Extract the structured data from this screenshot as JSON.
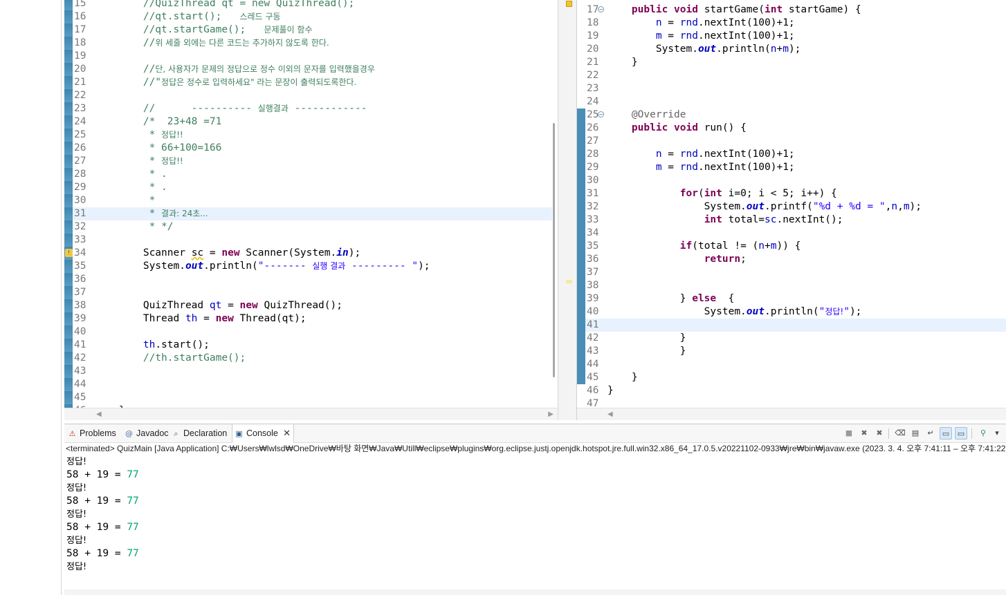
{
  "left_editor": {
    "lines": [
      {
        "n": "15",
        "segs": [
          [
            "cm",
            "        //QuizThread qt = new QuizThread();"
          ]
        ]
      },
      {
        "n": "16",
        "segs": [
          [
            "cm",
            "        //qt.start();   "
          ],
          [
            "cmk",
            "스레드 구동"
          ]
        ]
      },
      {
        "n": "17",
        "segs": [
          [
            "cm",
            "        //qt.startGame();   "
          ],
          [
            "cmk",
            "문제풀이 함수"
          ]
        ]
      },
      {
        "n": "18",
        "segs": [
          [
            "cm",
            "        //"
          ],
          [
            "cmk",
            "위 세줄 외에는 다른 코드는 추가하지 않도록 한다."
          ]
        ]
      },
      {
        "n": "19",
        "segs": []
      },
      {
        "n": "20",
        "segs": [
          [
            "cm",
            "        //"
          ],
          [
            "cmk",
            "단, 사용자가 문제의 정답으로 정수 이외의 문자를 입력했을경우"
          ]
        ]
      },
      {
        "n": "21",
        "segs": [
          [
            "cm",
            "        //\""
          ],
          [
            "cmk",
            "정답은 정수로 입력하세요\" 라는 문장이 출력되도록한다."
          ]
        ]
      },
      {
        "n": "22",
        "segs": []
      },
      {
        "n": "23",
        "segs": [
          [
            "cm",
            "        //      ---------- "
          ],
          [
            "cmk",
            "실행결과"
          ],
          [
            "cm",
            " ------------"
          ]
        ]
      },
      {
        "n": "24",
        "segs": [
          [
            "cm",
            "        /*  23+48 =71"
          ]
        ]
      },
      {
        "n": "25",
        "segs": [
          [
            "cm",
            "         * "
          ],
          [
            "cmk",
            "정답!!"
          ]
        ]
      },
      {
        "n": "26",
        "segs": [
          [
            "cm",
            "         * 66+100=166"
          ]
        ]
      },
      {
        "n": "27",
        "segs": [
          [
            "cm",
            "         * "
          ],
          [
            "cmk",
            "정답!!"
          ]
        ]
      },
      {
        "n": "28",
        "segs": [
          [
            "cm",
            "         * ."
          ]
        ]
      },
      {
        "n": "29",
        "segs": [
          [
            "cm",
            "         * ."
          ]
        ]
      },
      {
        "n": "30",
        "segs": [
          [
            "cm",
            "         *"
          ]
        ]
      },
      {
        "n": "31",
        "hl": true,
        "segs": [
          [
            "cm",
            "         * "
          ],
          [
            "cmk",
            "결과: 24초..."
          ]
        ]
      },
      {
        "n": "32",
        "segs": [
          [
            "cm",
            "         * */"
          ]
        ]
      },
      {
        "n": "33",
        "segs": []
      },
      {
        "n": "34",
        "warn": true,
        "segs": [
          [
            "pl",
            "        Scanner "
          ],
          [
            "warnvar",
            "sc"
          ],
          [
            "pl",
            " = "
          ],
          [
            "kw",
            "new"
          ],
          [
            "pl",
            " Scanner(System."
          ],
          [
            "sfld",
            "in"
          ],
          [
            "pl",
            ");"
          ]
        ]
      },
      {
        "n": "35",
        "segs": [
          [
            "pl",
            "        System."
          ],
          [
            "sfld",
            "out"
          ],
          [
            "pl",
            ".println("
          ],
          [
            "str",
            "\"------- "
          ],
          [
            "strk",
            "실행 결과"
          ],
          [
            "str",
            " --------- \""
          ],
          [
            "pl",
            ");"
          ]
        ]
      },
      {
        "n": "36",
        "segs": []
      },
      {
        "n": "37",
        "segs": []
      },
      {
        "n": "38",
        "segs": [
          [
            "pl",
            "        QuizThread "
          ],
          [
            "fldn",
            "qt"
          ],
          [
            "pl",
            " = "
          ],
          [
            "kw",
            "new"
          ],
          [
            "pl",
            " QuizThread();"
          ]
        ]
      },
      {
        "n": "39",
        "segs": [
          [
            "pl",
            "        Thread "
          ],
          [
            "fldn",
            "th"
          ],
          [
            "pl",
            " = "
          ],
          [
            "kw",
            "new"
          ],
          [
            "pl",
            " Thread(qt);"
          ]
        ]
      },
      {
        "n": "40",
        "segs": []
      },
      {
        "n": "41",
        "segs": [
          [
            "fldn",
            "        th"
          ],
          [
            "pl",
            ".start();"
          ]
        ]
      },
      {
        "n": "42",
        "segs": [
          [
            "cm",
            "        //th.startGame();"
          ]
        ]
      },
      {
        "n": "43",
        "segs": []
      },
      {
        "n": "44",
        "segs": []
      },
      {
        "n": "45",
        "segs": []
      },
      {
        "n": "46",
        "segs": [
          [
            "pl",
            "    }"
          ]
        ]
      }
    ]
  },
  "right_editor": {
    "lines": [
      {
        "n": "17",
        "fold": true,
        "segs": [
          [
            "pl",
            "    "
          ],
          [
            "kw",
            "public"
          ],
          [
            "pl",
            " "
          ],
          [
            "kw",
            "void"
          ],
          [
            "pl",
            " startGame("
          ],
          [
            "kw",
            "int"
          ],
          [
            "pl",
            " startGame) {"
          ]
        ]
      },
      {
        "n": "18",
        "segs": [
          [
            "pl",
            "        "
          ],
          [
            "fld",
            "n"
          ],
          [
            "pl",
            " = "
          ],
          [
            "fld",
            "rnd"
          ],
          [
            "pl",
            ".nextInt(100)+1;"
          ]
        ]
      },
      {
        "n": "19",
        "segs": [
          [
            "pl",
            "        "
          ],
          [
            "fld",
            "m"
          ],
          [
            "pl",
            " = "
          ],
          [
            "fld",
            "rnd"
          ],
          [
            "pl",
            ".nextInt(100)+1;"
          ]
        ]
      },
      {
        "n": "20",
        "segs": [
          [
            "pl",
            "        System."
          ],
          [
            "sfld",
            "out"
          ],
          [
            "pl",
            ".println("
          ],
          [
            "fld",
            "n"
          ],
          [
            "pl",
            "+"
          ],
          [
            "fld",
            "m"
          ],
          [
            "pl",
            ");"
          ]
        ]
      },
      {
        "n": "21",
        "segs": [
          [
            "pl",
            "    }"
          ]
        ]
      },
      {
        "n": "22",
        "segs": []
      },
      {
        "n": "23",
        "segs": []
      },
      {
        "n": "24",
        "segs": []
      },
      {
        "n": "25",
        "fold": true,
        "ruler": true,
        "segs": [
          [
            "ann",
            "    @Override"
          ]
        ]
      },
      {
        "n": "26",
        "ruler": true,
        "segs": [
          [
            "pl",
            "    "
          ],
          [
            "kw",
            "public"
          ],
          [
            "pl",
            " "
          ],
          [
            "kw",
            "void"
          ],
          [
            "pl",
            " run() {"
          ]
        ]
      },
      {
        "n": "27",
        "ruler": true,
        "segs": []
      },
      {
        "n": "28",
        "ruler": true,
        "segs": [
          [
            "pl",
            "        "
          ],
          [
            "fld",
            "n"
          ],
          [
            "pl",
            " = "
          ],
          [
            "fld",
            "rnd"
          ],
          [
            "pl",
            ".nextInt(100)+1;"
          ]
        ]
      },
      {
        "n": "29",
        "ruler": true,
        "segs": [
          [
            "pl",
            "        "
          ],
          [
            "fld",
            "m"
          ],
          [
            "pl",
            " = "
          ],
          [
            "fld",
            "rnd"
          ],
          [
            "pl",
            ".nextInt(100)+1;"
          ]
        ]
      },
      {
        "n": "30",
        "ruler": true,
        "segs": []
      },
      {
        "n": "31",
        "ruler": true,
        "segs": [
          [
            "pl",
            "            "
          ],
          [
            "kw",
            "for"
          ],
          [
            "pl",
            "("
          ],
          [
            "kw",
            "int"
          ],
          [
            "pl",
            " i=0; i < 5; i++) {"
          ]
        ]
      },
      {
        "n": "32",
        "ruler": true,
        "segs": [
          [
            "pl",
            "                System."
          ],
          [
            "sfld",
            "out"
          ],
          [
            "pl",
            ".printf("
          ],
          [
            "str",
            "\"%d + %d = \""
          ],
          [
            "pl",
            ","
          ],
          [
            "fld",
            "n"
          ],
          [
            "pl",
            ","
          ],
          [
            "fld",
            "m"
          ],
          [
            "pl",
            ");"
          ]
        ]
      },
      {
        "n": "33",
        "ruler": true,
        "segs": [
          [
            "pl",
            "                "
          ],
          [
            "kw",
            "int"
          ],
          [
            "pl",
            " total="
          ],
          [
            "fld",
            "sc"
          ],
          [
            "pl",
            ".nextInt();"
          ]
        ]
      },
      {
        "n": "34",
        "ruler": true,
        "segs": []
      },
      {
        "n": "35",
        "ruler": true,
        "segs": [
          [
            "pl",
            "            "
          ],
          [
            "kw",
            "if"
          ],
          [
            "pl",
            "(total != ("
          ],
          [
            "fld",
            "n"
          ],
          [
            "pl",
            "+"
          ],
          [
            "fld",
            "m"
          ],
          [
            "pl",
            ")) {"
          ]
        ]
      },
      {
        "n": "36",
        "ruler": true,
        "segs": [
          [
            "pl",
            "                "
          ],
          [
            "kw",
            "return"
          ],
          [
            "pl",
            ";"
          ]
        ]
      },
      {
        "n": "37",
        "ruler": true,
        "segs": []
      },
      {
        "n": "38",
        "ruler": true,
        "segs": []
      },
      {
        "n": "39",
        "ruler": true,
        "segs": [
          [
            "pl",
            "            } "
          ],
          [
            "kw",
            "else"
          ],
          [
            "pl",
            "  {"
          ]
        ]
      },
      {
        "n": "40",
        "ruler": true,
        "segs": [
          [
            "pl",
            "                System."
          ],
          [
            "sfld",
            "out"
          ],
          [
            "pl",
            ".println("
          ],
          [
            "str",
            "\""
          ],
          [
            "strk",
            "정답!"
          ],
          [
            "str",
            "\""
          ],
          [
            "pl",
            ");"
          ]
        ]
      },
      {
        "n": "41",
        "ruler": true,
        "hl": true,
        "segs": []
      },
      {
        "n": "42",
        "ruler": true,
        "segs": [
          [
            "pl",
            "            }"
          ]
        ]
      },
      {
        "n": "43",
        "ruler": true,
        "segs": [
          [
            "pl",
            "            }"
          ]
        ]
      },
      {
        "n": "44",
        "ruler": true,
        "segs": []
      },
      {
        "n": "45",
        "ruler": true,
        "segs": [
          [
            "pl",
            "    }"
          ]
        ]
      },
      {
        "n": "46",
        "segs": [
          [
            "pl",
            "}"
          ]
        ]
      },
      {
        "n": "47",
        "segs": []
      }
    ]
  },
  "console": {
    "tabs": [
      {
        "name": "problems",
        "label": "Problems",
        "icon": "problems-icon",
        "glyph": "⚠"
      },
      {
        "name": "javadoc",
        "label": "Javadoc",
        "icon": "at-icon",
        "glyph": "@"
      },
      {
        "name": "declaration",
        "label": "Declaration",
        "icon": "declaration-icon",
        "glyph": "⌕"
      },
      {
        "name": "console",
        "label": "Console",
        "icon": "console-icon",
        "glyph": "▣",
        "active": true
      }
    ],
    "toolbar": [
      {
        "name": "terminate-icon",
        "glyph": "■"
      },
      {
        "name": "remove-launch-icon",
        "glyph": "✖"
      },
      {
        "name": "remove-all-terminated-icon",
        "glyph": "✖"
      },
      {
        "name": "clear-console-icon",
        "glyph": "⌫"
      },
      {
        "name": "scroll-lock-icon",
        "glyph": "▤"
      },
      {
        "name": "word-wrap-icon",
        "glyph": "↵"
      },
      {
        "name": "show-console-on-output-icon",
        "glyph": "▭",
        "pressed": true
      },
      {
        "name": "show-console-on-error-icon",
        "glyph": "▭",
        "pressed": true
      },
      {
        "name": "pin-console-icon",
        "glyph": "⚲"
      },
      {
        "name": "display-selected-console-icon",
        "glyph": "▾"
      }
    ],
    "header": "<terminated> QuizMain [Java Application] C:₩Users₩lwlsd₩OneDrive₩바탕 화면₩Java₩Utill₩eclipse₩plugins₩org.eclipse.justj.openjdk.hotspot.jre.full.win32.x86_64_17.0.5.v20221102-0933₩jre₩bin₩javaw.exe  (2023. 3. 4. 오후 7:41:11 – 오후 7:41:22)",
    "output": [
      {
        "kind": "kr",
        "text": "정답!"
      },
      {
        "kind": "calc",
        "text": "58 + 19 = ",
        "input": "77"
      },
      {
        "kind": "kr",
        "text": "정답!"
      },
      {
        "kind": "calc",
        "text": "58 + 19 = ",
        "input": "77"
      },
      {
        "kind": "kr",
        "text": "정답!"
      },
      {
        "kind": "calc",
        "text": "58 + 19 = ",
        "input": "77"
      },
      {
        "kind": "kr",
        "text": "정답!"
      },
      {
        "kind": "calc",
        "text": "58 + 19 = ",
        "input": "77"
      },
      {
        "kind": "kr",
        "text": "정답!"
      }
    ]
  },
  "colors": {
    "keyword": "#7f0055",
    "comment": "#3f7f5f",
    "string": "#2a00ff",
    "field": "#0000c0",
    "console_input": "#00a86b",
    "line_highlight": "#e8f2fe",
    "ruler": "#4a8db5"
  }
}
